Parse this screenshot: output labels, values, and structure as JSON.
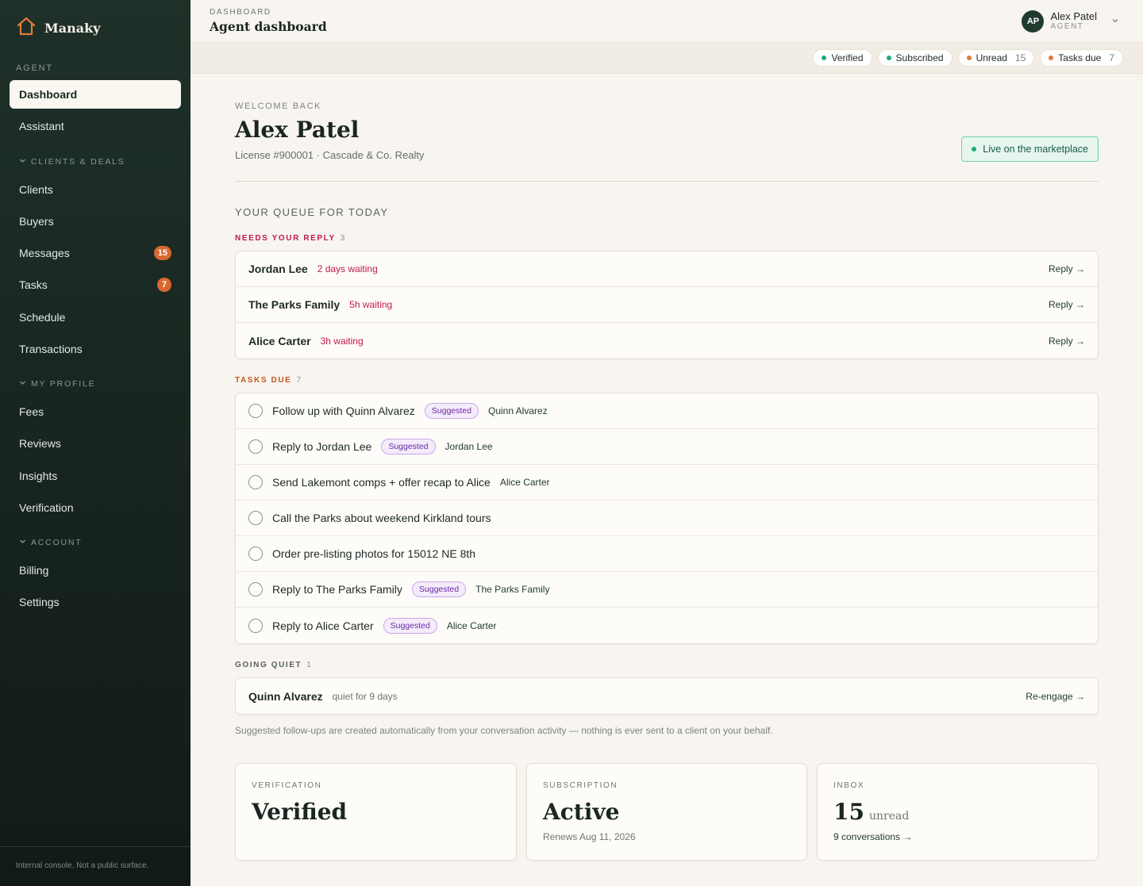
{
  "brand": {
    "name": "Manaky",
    "icon": "house-icon",
    "accent": "#e07a3c"
  },
  "sidebar": {
    "agent_label": "AGENT",
    "items_top": [
      {
        "label": "Dashboard",
        "active": true
      },
      {
        "label": "Assistant"
      }
    ],
    "section_clients": "CLIENTS & DEALS",
    "items_clients": [
      {
        "label": "Clients"
      },
      {
        "label": "Buyers"
      },
      {
        "label": "Messages",
        "badge": "15"
      },
      {
        "label": "Tasks",
        "badge": "7"
      },
      {
        "label": "Schedule"
      },
      {
        "label": "Transactions"
      }
    ],
    "section_profile": "MY PROFILE",
    "items_profile": [
      {
        "label": "Fees"
      },
      {
        "label": "Reviews"
      },
      {
        "label": "Insights"
      },
      {
        "label": "Verification"
      }
    ],
    "section_account": "ACCOUNT",
    "items_account": [
      {
        "label": "Billing"
      },
      {
        "label": "Settings"
      }
    ],
    "footer": "Internal console. Not a public surface."
  },
  "header": {
    "breadcrumb": "DASHBOARD",
    "title": "Agent dashboard",
    "user": {
      "initials": "AP",
      "name": "Alex Patel",
      "role": "AGENT"
    }
  },
  "status_pills": [
    {
      "label": "Verified",
      "color": "#1fa97a"
    },
    {
      "label": "Subscribed",
      "color": "#1fa97a"
    },
    {
      "label": "Unread",
      "count": "15",
      "color": "#e07a3c"
    },
    {
      "label": "Tasks due",
      "count": "7",
      "color": "#e07a3c"
    }
  ],
  "welcome": {
    "eyebrow": "WELCOME BACK",
    "name": "Alex Patel",
    "license": "License #900001 · Cascade & Co. Realty",
    "live_badge": "Live on the marketplace"
  },
  "queue": {
    "title": "YOUR QUEUE FOR TODAY",
    "needs_reply": {
      "label": "NEEDS YOUR REPLY",
      "count": "3",
      "color": "#c0194a",
      "rows": [
        {
          "name": "Jordan Lee",
          "wait": "2 days waiting",
          "action": "Reply →"
        },
        {
          "name": "The Parks Family",
          "wait": "5h waiting",
          "action": "Reply →"
        },
        {
          "name": "Alice Carter",
          "wait": "3h waiting",
          "action": "Reply →"
        }
      ]
    },
    "tasks_due": {
      "label": "TASKS DUE",
      "count": "7",
      "color": "#c2581c",
      "rows": [
        {
          "text": "Follow up with Quinn Alvarez",
          "tag": "Suggested",
          "assignee": "Quinn Alvarez"
        },
        {
          "text": "Reply to Jordan Lee",
          "tag": "Suggested",
          "assignee": "Jordan Lee"
        },
        {
          "text": "Send Lakemont comps + offer recap to Alice",
          "tag": "",
          "assignee": "Alice Carter"
        },
        {
          "text": "Call the Parks about weekend Kirkland tours",
          "tag": "",
          "assignee": ""
        },
        {
          "text": "Order pre-listing photos for 15012 NE 8th",
          "tag": "",
          "assignee": ""
        },
        {
          "text": "Reply to The Parks Family",
          "tag": "Suggested",
          "assignee": "The Parks Family"
        },
        {
          "text": "Reply to Alice Carter",
          "tag": "Suggested",
          "assignee": "Alice Carter"
        }
      ]
    },
    "going_quiet": {
      "label": "GOING QUIET",
      "count": "1",
      "color": "#59625d",
      "rows": [
        {
          "name": "Quinn Alvarez",
          "quiet": "quiet for 9 days",
          "action": "Re-engage →"
        }
      ]
    },
    "footnote": "Suggested follow-ups are created automatically from your conversation activity — nothing is ever sent to a client on your behalf."
  },
  "stats": [
    {
      "label": "VERIFICATION",
      "value": "Verified",
      "unit": "",
      "sub": "",
      "link": false
    },
    {
      "label": "SUBSCRIPTION",
      "value": "Active",
      "unit": "",
      "sub": "Renews Aug 11, 2026",
      "link": false
    },
    {
      "label": "INBOX",
      "value": "15",
      "unit": "unread",
      "sub": "9 conversations →",
      "link": true
    }
  ]
}
